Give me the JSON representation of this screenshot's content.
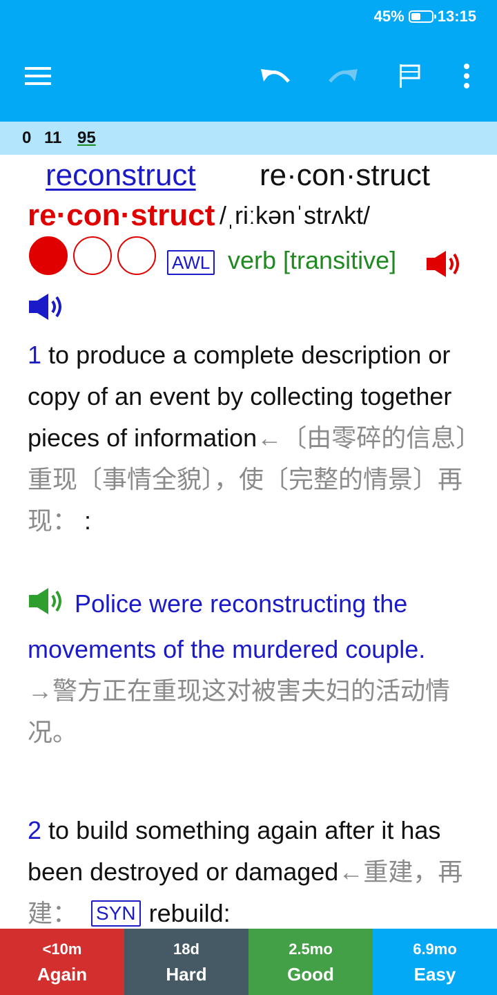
{
  "status_bar": {
    "battery_percent": "45%",
    "battery_level": 0.45,
    "time": "13:15"
  },
  "toolbar": {
    "icons": [
      "menu-icon",
      "undo-icon",
      "redo-icon",
      "flag-icon",
      "more-vert-icon"
    ]
  },
  "counts": {
    "new": "0",
    "learning": "11",
    "review": "95"
  },
  "entry": {
    "headword_link": "reconstruct",
    "syllables": "re·con·struct",
    "syllables_red": "re·con·struct",
    "pronunciation": "/ˌriːkənˈstrʌkt/",
    "frequency_level": 1,
    "frequency_max": 3,
    "awl_tag": "AWL",
    "part_of_speech": "verb [transitive]",
    "senses": [
      {
        "number": "1",
        "definition": "to produce a complete description or copy of an event by collecting together pieces of information",
        "translation": "←〔由零碎的信息〕重现〔事情全貌〕，使〔完整的情景〕再现：",
        "colon": ":",
        "example": "Police were reconstructing the movements of the murdered couple.",
        "example_translation": "→警方正在重现这对被害夫妇的活动情况。"
      },
      {
        "number": "2",
        "definition": "to build something again after it has been destroyed or damaged",
        "translation": "←重建，再建：",
        "syn_tag": "SYN",
        "synonym": "rebuild:"
      }
    ]
  },
  "answer_buttons": [
    {
      "interval": "<10m",
      "label": "Again",
      "color": "#d32f2f"
    },
    {
      "interval": "18d",
      "label": "Hard",
      "color": "#455a64"
    },
    {
      "interval": "2.5mo",
      "label": "Good",
      "color": "#43a047"
    },
    {
      "interval": "6.9mo",
      "label": "Easy",
      "color": "#03a9f4"
    }
  ],
  "colors": {
    "accent": "#03a9f4",
    "count_bar": "#b3e5fc",
    "link_blue": "#1a1ac8",
    "headword_red": "#e00000",
    "pos_green": "#1f8a1f"
  }
}
